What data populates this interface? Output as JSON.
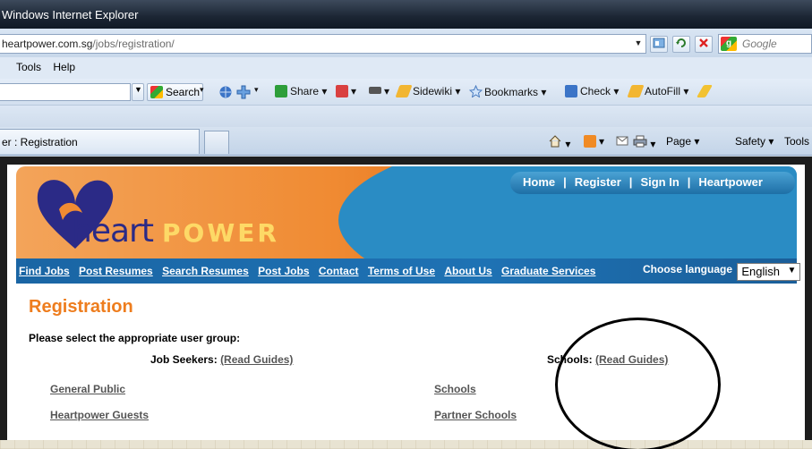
{
  "browser": {
    "title": "Windows Internet Explorer",
    "address": {
      "domain": "heartpower.com.sg",
      "path": "/jobs/registration/"
    },
    "search_placeholder": "Google",
    "menu": [
      "Tools",
      "Help"
    ],
    "toolbar": {
      "search_label": "Search",
      "share": "Share",
      "sidewiki": "Sidewiki",
      "bookmarks": "Bookmarks",
      "check": "Check",
      "autofill": "AutoFill"
    },
    "tab_title": "er : Registration",
    "command_bar": {
      "page": "Page",
      "safety": "Safety",
      "tools": "Tools"
    }
  },
  "site": {
    "logo": {
      "heart": "heart",
      "power": "POWER"
    },
    "top_links": [
      "Home",
      "Register",
      "Sign In",
      "Heartpower"
    ],
    "nav": [
      "Find Jobs",
      "Post Resumes",
      "Search Resumes",
      "Post Jobs",
      "Contact",
      "Terms of Use",
      "About Us",
      "Graduate Services"
    ],
    "language_label": "Choose language",
    "language_value": "English"
  },
  "registration": {
    "title": "Registration",
    "instruction": "Please select the appropriate user group:",
    "job_seekers": {
      "label": "Job Seekers:",
      "guide_link": "(Read Guides)",
      "items": [
        "General Public",
        "Heartpower Guests"
      ]
    },
    "schools": {
      "label": "Schools:",
      "guide_link": "(Read Guides)",
      "items": [
        "Schools",
        "Partner Schools"
      ]
    }
  },
  "colors": {
    "accent_orange": "#ee7d1e",
    "nav_blue": "#1e72b4",
    "logo_navy": "#2b2a86"
  }
}
